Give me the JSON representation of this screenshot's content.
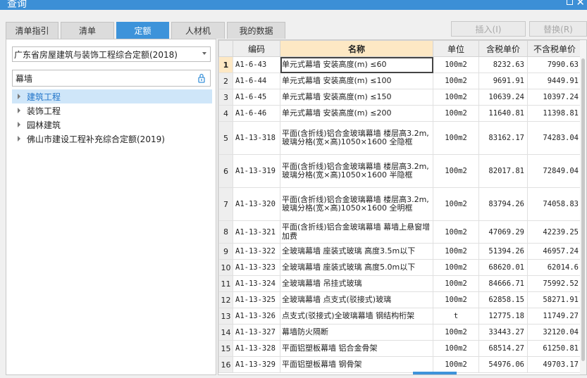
{
  "window": {
    "title": "查询"
  },
  "tabs": [
    {
      "label": "清单指引",
      "active": false
    },
    {
      "label": "清单",
      "active": false
    },
    {
      "label": "定额",
      "active": true
    },
    {
      "label": "人材机",
      "active": false
    },
    {
      "label": "我的数据",
      "active": false
    }
  ],
  "toolbar": {
    "insert_label": "插入(I)",
    "replace_label": "替换(R)"
  },
  "left": {
    "library": "广东省房屋建筑与装饰工程综合定额(2018)",
    "search_value": "幕墙",
    "tree": [
      {
        "label": "建筑工程",
        "selected": true
      },
      {
        "label": "装饰工程",
        "selected": false
      },
      {
        "label": "园林建筑",
        "selected": false
      },
      {
        "label": "佛山市建设工程补充综合定额(2019)",
        "selected": false
      }
    ]
  },
  "grid": {
    "headers": {
      "idx": "",
      "code": "编码",
      "name": "名称",
      "unit": "单位",
      "price_tax": "含税单价",
      "price_notax": "不含税单价"
    },
    "rows": [
      {
        "idx": "1",
        "code": "A1-6-43",
        "name": "单元式幕墙 安装高度(m) ≤60",
        "unit": "100m2",
        "price_tax": "8232.63",
        "price_notax": "7990.63"
      },
      {
        "idx": "2",
        "code": "A1-6-44",
        "name": "单元式幕墙 安装高度(m) ≤100",
        "unit": "100m2",
        "price_tax": "9691.91",
        "price_notax": "9449.91"
      },
      {
        "idx": "3",
        "code": "A1-6-45",
        "name": "单元式幕墙 安装高度(m) ≤150",
        "unit": "100m2",
        "price_tax": "10639.24",
        "price_notax": "10397.24"
      },
      {
        "idx": "4",
        "code": "A1-6-46",
        "name": "单元式幕墙 安装高度(m) ≤200",
        "unit": "100m2",
        "price_tax": "11640.81",
        "price_notax": "11398.81"
      },
      {
        "idx": "5",
        "code": "A1-13-318",
        "name": "平面(含折线)铝合金玻璃幕墙 楼层高3.2m,玻璃分格(宽×高)1050×1600 全隐框",
        "unit": "100m2",
        "price_tax": "83162.17",
        "price_notax": "74283.04"
      },
      {
        "idx": "6",
        "code": "A1-13-319",
        "name": "平面(含折线)铝合金玻璃幕墙 楼层高3.2m,玻璃分格(宽×高)1050×1600 半隐框",
        "unit": "100m2",
        "price_tax": "82017.81",
        "price_notax": "72849.04"
      },
      {
        "idx": "7",
        "code": "A1-13-320",
        "name": "平面(含折线)铝合金玻璃幕墙 楼层高3.2m,玻璃分格(宽×高)1050×1600 全明框",
        "unit": "100m2",
        "price_tax": "83794.26",
        "price_notax": "74058.83"
      },
      {
        "idx": "8",
        "code": "A1-13-321",
        "name": "平面(含折线)铝合金玻璃幕墙 幕墙上悬窗增加费",
        "unit": "100m2",
        "price_tax": "47069.29",
        "price_notax": "42239.25"
      },
      {
        "idx": "9",
        "code": "A1-13-322",
        "name": "全玻璃幕墙 座装式玻璃 高度3.5m以下",
        "unit": "100m2",
        "price_tax": "51394.26",
        "price_notax": "46957.24"
      },
      {
        "idx": "10",
        "code": "A1-13-323",
        "name": "全玻璃幕墙 座装式玻璃 高度5.0m以下",
        "unit": "100m2",
        "price_tax": "68620.01",
        "price_notax": "62014.6"
      },
      {
        "idx": "11",
        "code": "A1-13-324",
        "name": "全玻璃幕墙 吊挂式玻璃",
        "unit": "100m2",
        "price_tax": "84666.71",
        "price_notax": "75992.52"
      },
      {
        "idx": "12",
        "code": "A1-13-325",
        "name": "全玻璃幕墙 点支式(驳接式)玻璃",
        "unit": "100m2",
        "price_tax": "62858.15",
        "price_notax": "58271.91"
      },
      {
        "idx": "13",
        "code": "A1-13-326",
        "name": "点支式(驳接式)全玻璃幕墙 钢结构桁架",
        "unit": "t",
        "price_tax": "12775.18",
        "price_notax": "11749.27"
      },
      {
        "idx": "14",
        "code": "A1-13-327",
        "name": "幕墙防火隔断",
        "unit": "100m2",
        "price_tax": "33443.27",
        "price_notax": "32120.04"
      },
      {
        "idx": "15",
        "code": "A1-13-328",
        "name": "平面铝塑板幕墙 铝合金骨架",
        "unit": "100m2",
        "price_tax": "68514.27",
        "price_notax": "61250.81"
      },
      {
        "idx": "16",
        "code": "A1-13-329",
        "name": "平面铝塑板幕墙 钢骨架",
        "unit": "100m2",
        "price_tax": "54976.06",
        "price_notax": "49703.17"
      }
    ]
  },
  "colors": {
    "accent": "#3d93da",
    "header_highlight": "#fde8c4",
    "tree_selected": "#cfe6f9"
  }
}
